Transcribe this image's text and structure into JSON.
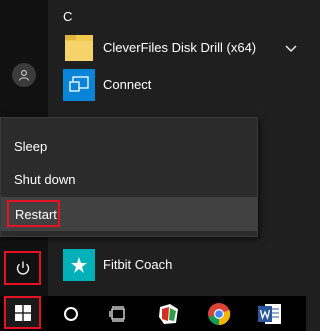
{
  "start_menu": {
    "section_letter": "C",
    "apps": [
      {
        "label": "CleverFiles Disk Drill (x64)",
        "icon": "folder-icon",
        "color": "#f2c94c",
        "has_expand": true
      },
      {
        "label": "Connect",
        "icon": "connect-icon",
        "color": "#0a84d6",
        "has_expand": false
      },
      {
        "label": "Fitbit Coach",
        "icon": "fitbit-star-icon",
        "color": "#00b0b9",
        "has_expand": false
      }
    ]
  },
  "power_menu": {
    "items": [
      {
        "label": "Sleep"
      },
      {
        "label": "Shut down"
      },
      {
        "label": "Restart"
      }
    ]
  },
  "rail": {
    "account_icon": "user-icon",
    "power_icon": "power-icon"
  },
  "taskbar": {
    "icons": [
      "windows-logo-icon",
      "cortana-circle-icon",
      "task-view-icon",
      "app-icon",
      "chrome-icon",
      "word-icon"
    ]
  },
  "colors": {
    "highlight": "#e81123",
    "tile_blue": "#0a84d6",
    "tile_teal": "#00b0b9"
  }
}
